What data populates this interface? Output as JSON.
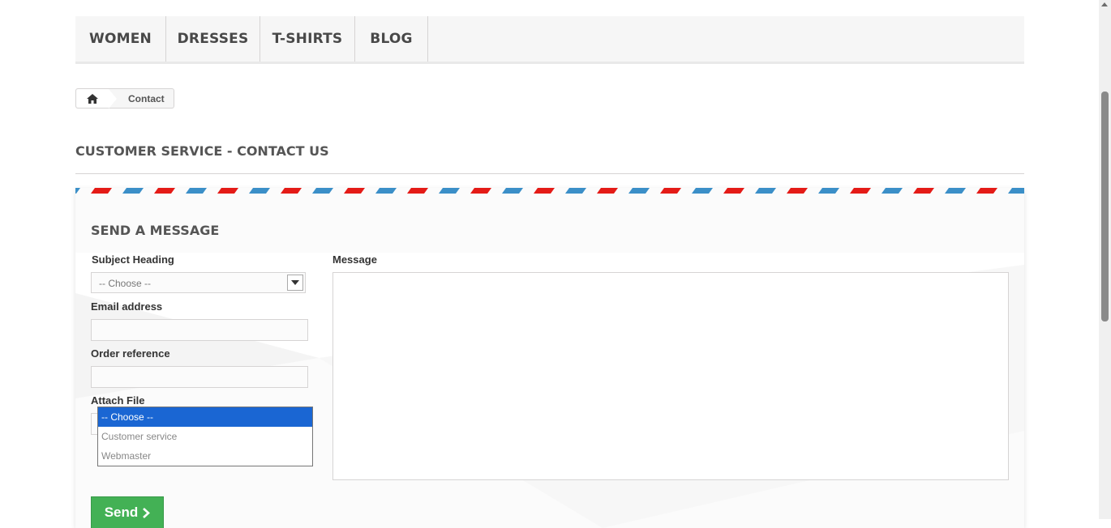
{
  "nav": {
    "items": [
      {
        "label": "WOMEN"
      },
      {
        "label": "DRESSES"
      },
      {
        "label": "T-SHIRTS"
      },
      {
        "label": "BLOG"
      }
    ]
  },
  "breadcrumb": {
    "home_icon": "home-icon",
    "current": "Contact"
  },
  "page": {
    "heading": "CUSTOMER SERVICE - CONTACT US"
  },
  "form": {
    "title": "SEND A MESSAGE",
    "subject_label": "Subject Heading",
    "subject_value": "-- Choose --",
    "subject_options": [
      "-- Choose --",
      "Customer service",
      "Webmaster"
    ],
    "email_label": "Email address",
    "email_value": "",
    "order_label": "Order reference",
    "order_value": "",
    "attach_label": "Attach File",
    "message_label": "Message",
    "message_value": "",
    "send_label": "Send",
    "send_icon": "chevron-right-icon"
  },
  "colors": {
    "accent_green": "#43b155",
    "stripe_red": "#e41b17",
    "stripe_blue": "#3b8fc8",
    "selected_option": "#1a66d3"
  }
}
